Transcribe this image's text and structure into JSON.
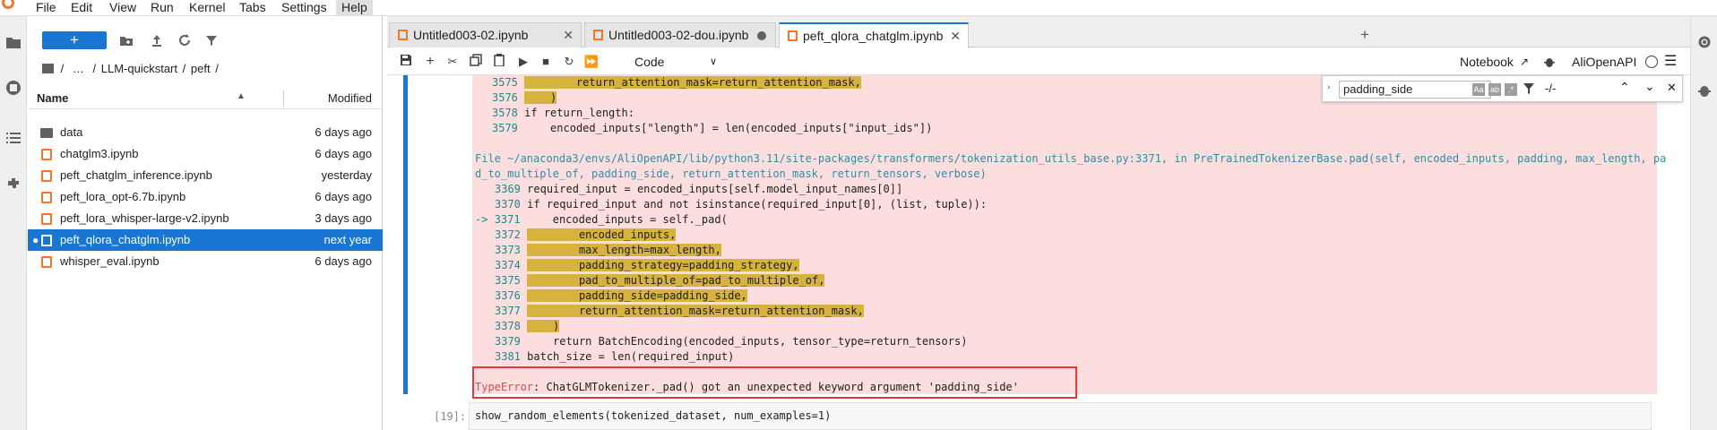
{
  "menubar": {
    "items": [
      "File",
      "Edit",
      "View",
      "Run",
      "Kernel",
      "Tabs",
      "Settings",
      "Help"
    ]
  },
  "filebrowser": {
    "new_label": "+",
    "breadcrumb": [
      "/",
      "…",
      "/",
      "LLM-quickstart",
      "/",
      "peft",
      "/"
    ],
    "col_name": "Name",
    "col_modified": "Modified",
    "rows": [
      {
        "name": "data",
        "modified": "6 days ago",
        "kind": "folder"
      },
      {
        "name": "chatglm3.ipynb",
        "modified": "6 days ago",
        "kind": "notebook"
      },
      {
        "name": "peft_chatglm_inference.ipynb",
        "modified": "yesterday",
        "kind": "notebook"
      },
      {
        "name": "peft_lora_opt-6.7b.ipynb",
        "modified": "6 days ago",
        "kind": "notebook"
      },
      {
        "name": "peft_lora_whisper-large-v2.ipynb",
        "modified": "3 days ago",
        "kind": "notebook"
      },
      {
        "name": "peft_qlora_chatglm.ipynb",
        "modified": "next year",
        "kind": "notebook",
        "selected": true
      },
      {
        "name": "whisper_eval.ipynb",
        "modified": "6 days ago",
        "kind": "notebook"
      }
    ]
  },
  "tabs": [
    {
      "label": "Untitled003-02.ipynb"
    },
    {
      "label": "Untitled003-02-dou.ipynb"
    },
    {
      "label": "peft_qlora_chatglm.ipynb"
    }
  ],
  "toolbar": {
    "cell_type": "Code",
    "notebook_label": "Notebook",
    "kernel_name": "AliOpenAPI"
  },
  "search": {
    "query": "padding_side",
    "match_count": "-/-",
    "opt_case": "Aa",
    "opt_word": "ab",
    "opt_regex": ".*"
  },
  "traceback": {
    "lines_top": [
      {
        "num": "3575",
        "text": "        return_attention_mask=return_attention_mask,",
        "hl": true
      },
      {
        "num": "3576",
        "text": "    )",
        "hl": true
      },
      {
        "num": "3578",
        "text": "if return_length:",
        "hl": false
      },
      {
        "num": "3579",
        "text": "    encoded_inputs[\"length\"] = len(encoded_inputs[\"input_ids\"])",
        "hl": false
      }
    ],
    "file_line_1": "File ~/anaconda3/envs/AliOpenAPI/lib/python3.11/site-packages/transformers/tokenization_utils_base.py:3371, in PreTrainedTokenizerBase.pad(self, encoded_inputs, padding, max_length, pa",
    "file_line_2": "d_to_multiple_of, padding_side, return_attention_mask, return_tensors, verbose)",
    "lines_bottom": [
      {
        "num": "3369",
        "text": "required_input = encoded_inputs[self.model_input_names[0]]",
        "hl": false,
        "arrow": ""
      },
      {
        "num": "3370",
        "text": "if required_input and not isinstance(required_input[0], (list, tuple)):",
        "hl": false,
        "arrow": ""
      },
      {
        "num": "3371",
        "text": "    encoded_inputs = self._pad(",
        "hl": false,
        "arrow": "-> "
      },
      {
        "num": "3372",
        "text": "        encoded_inputs,",
        "hl": true,
        "arrow": ""
      },
      {
        "num": "3373",
        "text": "        max_length=max_length,",
        "hl": true,
        "arrow": ""
      },
      {
        "num": "3374",
        "text": "        padding_strategy=padding_strategy,",
        "hl": true,
        "arrow": ""
      },
      {
        "num": "3375",
        "text": "        pad_to_multiple_of=pad_to_multiple_of,",
        "hl": true,
        "arrow": ""
      },
      {
        "num": "3376",
        "text": "        padding_side=padding_side,",
        "hl": true,
        "arrow": ""
      },
      {
        "num": "3377",
        "text": "        return_attention_mask=return_attention_mask,",
        "hl": true,
        "arrow": ""
      },
      {
        "num": "3378",
        "text": "    )",
        "hl": true,
        "arrow": ""
      },
      {
        "num": "3379",
        "text": "    return BatchEncoding(encoded_inputs, tensor_type=return_tensors)",
        "hl": false,
        "arrow": ""
      },
      {
        "num": "3381",
        "text": "batch_size = len(required_input)",
        "hl": false,
        "arrow": ""
      }
    ],
    "error_type": "TypeError",
    "error_message": ": ChatGLMTokenizer._pad() got an unexpected keyword argument 'padding_side'"
  },
  "next_cell": {
    "prompt": "[19]:",
    "code": "show_random_elements(tokenized_dataset, num_examples=1)"
  }
}
